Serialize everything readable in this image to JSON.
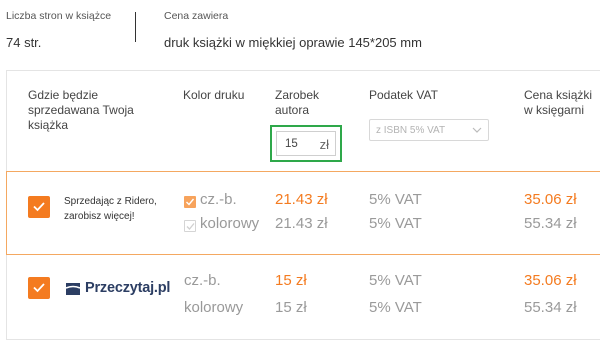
{
  "info": {
    "pages_label": "Liczba stron w książce",
    "pages_value": "74 str.",
    "price_includes_label": "Cena zawiera",
    "price_includes_value": "druk książki w miękkiej oprawie 145*205 mm"
  },
  "table": {
    "headers": {
      "where_sold": "Gdzie będzie sprzedawana Twoja książka",
      "print_color": "Kolor druku",
      "author_earnings": "Zarobek autora",
      "vat": "Podatek VAT",
      "bookstore_price": "Cena książki w księgarni"
    },
    "earnings_input": {
      "value": "15",
      "currency": "zł"
    },
    "vat_select": {
      "selected": "z ISBN 5% VAT"
    },
    "rows": [
      {
        "channel_text": "Sprzedając z Ridero, zarobisz więcej!",
        "checked": true,
        "variants": [
          {
            "type": "cz.-b.",
            "type_checked": true,
            "earnings": "21.43 zł",
            "vat": "5% VAT",
            "price": "35.06 zł"
          },
          {
            "type": "kolorowy",
            "type_checked": false,
            "earnings": "21.43 zł",
            "vat": "5% VAT",
            "price": "55.34 zł"
          }
        ]
      },
      {
        "channel_logo": "Przeczytaj.pl",
        "checked": true,
        "variants": [
          {
            "type": "cz.-b.",
            "earnings": "15 zł",
            "vat": "5% VAT",
            "price": "35.06 zł"
          },
          {
            "type": "kolorowy",
            "earnings": "15 zł",
            "vat": "5% VAT",
            "price": "55.34 zł"
          }
        ]
      }
    ]
  },
  "colors": {
    "accent_orange": "#f47b20",
    "highlight_green": "#2ea84a",
    "row_border": "#f4a861",
    "logo_navy": "#2c3e63"
  },
  "icons": [
    "checkmark-icon",
    "chevron-down-icon",
    "przeczytaj-logo-icon"
  ]
}
